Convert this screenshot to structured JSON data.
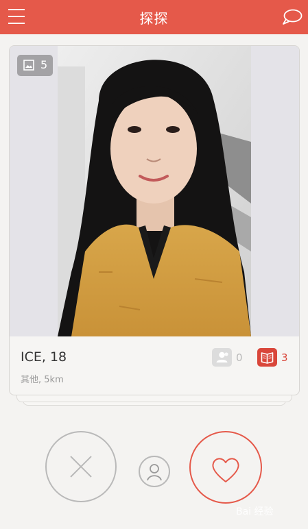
{
  "header": {
    "title": "探探",
    "menu_icon": "hamburger-menu-icon",
    "chat_icon": "chat-bubble-icon",
    "color": "#e5594a"
  },
  "card": {
    "photo_count": "5",
    "photo_count_icon": "image-icon",
    "name_age": "ICE, 18",
    "location": "其他, 5km",
    "mutual_friends_count": "0",
    "mutual_friends_icon": "person-icon",
    "common_interests_count": "3",
    "common_interests_icon": "book-icon",
    "accent": "#d9463a"
  },
  "actions": {
    "dislike_icon": "close-x-icon",
    "profile_icon": "user-profile-icon",
    "like_icon": "heart-icon"
  },
  "watermark": {
    "text": "Bai 经验"
  }
}
